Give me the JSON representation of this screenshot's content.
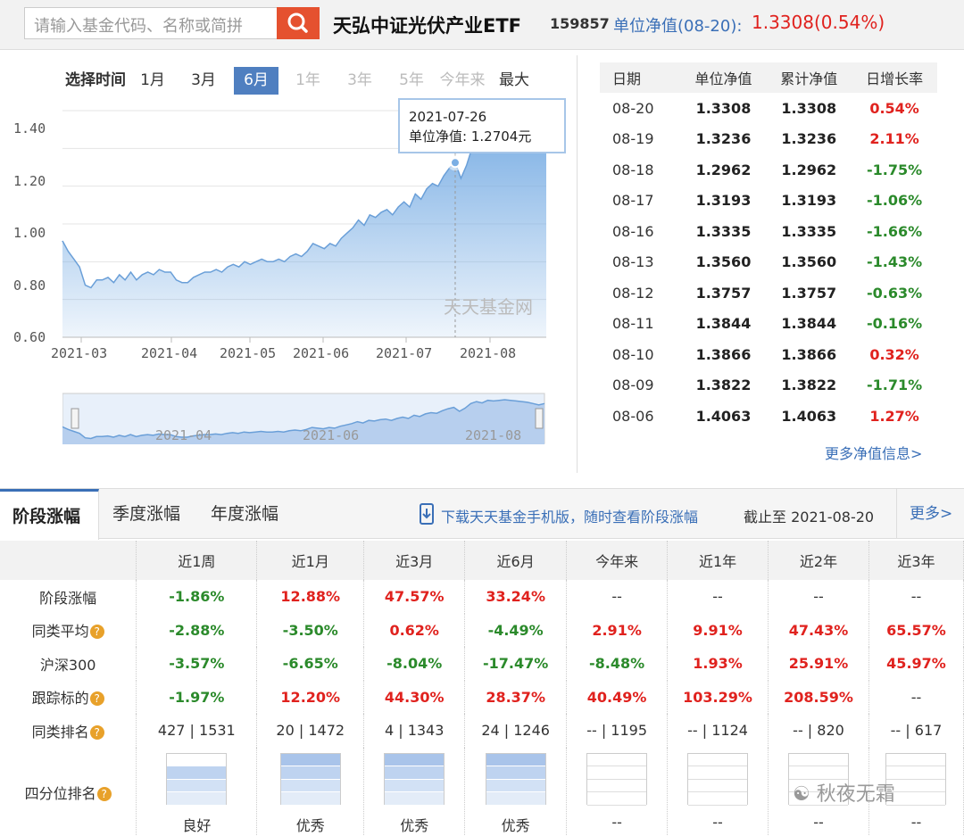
{
  "search": {
    "placeholder": "请输入基金代码、名称或简拼"
  },
  "fund": {
    "name": "天弘中证光伏产业ETF",
    "code": "159857",
    "nav_label": "单位净值(08-20):",
    "nav_value": "1.3308(0.54%)"
  },
  "chart_controls": {
    "label": "选择时间",
    "tabs": [
      "1月",
      "3月",
      "6月",
      "1年",
      "3年",
      "5年",
      "今年来",
      "最大"
    ],
    "active": "6月",
    "disabled": [
      "1年",
      "3年",
      "5年",
      "今年来"
    ]
  },
  "chart_data": {
    "type": "area",
    "x_ticks": [
      "2021-03",
      "2021-04",
      "2021-05",
      "2021-06",
      "2021-07",
      "2021-08"
    ],
    "y_ticks": [
      "0.60",
      "0.80",
      "1.00",
      "1.20",
      "1.40"
    ],
    "ylim": [
      0.6,
      1.47
    ],
    "values": [
      0.97,
      0.93,
      0.9,
      0.87,
      0.8,
      0.79,
      0.82,
      0.82,
      0.83,
      0.81,
      0.84,
      0.82,
      0.85,
      0.82,
      0.84,
      0.85,
      0.84,
      0.86,
      0.85,
      0.85,
      0.82,
      0.81,
      0.81,
      0.83,
      0.84,
      0.85,
      0.85,
      0.86,
      0.85,
      0.87,
      0.88,
      0.87,
      0.89,
      0.88,
      0.89,
      0.9,
      0.89,
      0.89,
      0.9,
      0.89,
      0.91,
      0.92,
      0.91,
      0.93,
      0.96,
      0.95,
      0.94,
      0.96,
      0.95,
      0.98,
      1.0,
      1.02,
      1.05,
      1.03,
      1.07,
      1.06,
      1.08,
      1.09,
      1.07,
      1.1,
      1.12,
      1.1,
      1.15,
      1.13,
      1.17,
      1.19,
      1.18,
      1.22,
      1.25,
      1.2704,
      1.21,
      1.26,
      1.33,
      1.36,
      1.34,
      1.38,
      1.37,
      1.38,
      1.39,
      1.38,
      1.37,
      1.36,
      1.35,
      1.33,
      1.31,
      1.3308
    ],
    "tooltip": {
      "date": "2021-07-26",
      "label": "单位净值:",
      "value": "1.2704元"
    },
    "navigator_ticks": [
      "2021-04",
      "2021-06",
      "2021-08"
    ],
    "watermark": "天天基金网",
    "color": "#7aaee4"
  },
  "nav_table": {
    "headers": [
      "日期",
      "单位净值",
      "累计净值",
      "日增长率"
    ],
    "rows": [
      [
        "08-20",
        "1.3308",
        "1.3308",
        "0.54%"
      ],
      [
        "08-19",
        "1.3236",
        "1.3236",
        "2.11%"
      ],
      [
        "08-18",
        "1.2962",
        "1.2962",
        "-1.75%"
      ],
      [
        "08-17",
        "1.3193",
        "1.3193",
        "-1.06%"
      ],
      [
        "08-16",
        "1.3335",
        "1.3335",
        "-1.66%"
      ],
      [
        "08-13",
        "1.3560",
        "1.3560",
        "-1.43%"
      ],
      [
        "08-12",
        "1.3757",
        "1.3757",
        "-0.63%"
      ],
      [
        "08-11",
        "1.3844",
        "1.3844",
        "-0.16%"
      ],
      [
        "08-10",
        "1.3866",
        "1.3866",
        "0.32%"
      ],
      [
        "08-09",
        "1.3822",
        "1.3822",
        "-1.71%"
      ],
      [
        "08-06",
        "1.4063",
        "1.4063",
        "1.27%"
      ]
    ],
    "more": "更多净值信息>"
  },
  "bottom": {
    "tabs": [
      "阶段涨幅",
      "季度涨幅",
      "年度涨幅"
    ],
    "download": "下载天天基金手机版，随时查看阶段涨幅",
    "asof": "截止至  2021-08-20",
    "more": "更多>",
    "headers": [
      "",
      "近1周",
      "近1月",
      "近3月",
      "近6月",
      "今年来",
      "近1年",
      "近2年",
      "近3年"
    ],
    "rows": [
      {
        "label": "阶段涨幅",
        "help": false,
        "cells": [
          "-1.86%",
          "12.88%",
          "47.57%",
          "33.24%",
          "--",
          "--",
          "--",
          "--"
        ]
      },
      {
        "label": "同类平均",
        "help": true,
        "cells": [
          "-2.88%",
          "-3.50%",
          "0.62%",
          "-4.49%",
          "2.91%",
          "9.91%",
          "47.43%",
          "65.57%"
        ]
      },
      {
        "label": "沪深300",
        "help": false,
        "cells": [
          "-3.57%",
          "-6.65%",
          "-8.04%",
          "-17.47%",
          "-8.48%",
          "1.93%",
          "25.91%",
          "45.97%"
        ]
      },
      {
        "label": "跟踪标的",
        "help": true,
        "cells": [
          "-1.97%",
          "12.20%",
          "44.30%",
          "28.37%",
          "40.49%",
          "103.29%",
          "208.59%",
          "--"
        ]
      },
      {
        "label": "同类排名",
        "help": true,
        "cells": [
          "427 | 1531",
          "20 | 1472",
          "4 | 1343",
          "24 | 1246",
          "-- | 1195",
          "-- | 1124",
          "-- | 820",
          "-- | 617"
        ]
      }
    ],
    "quartile_label": "四分位排名",
    "quartile": [
      {
        "level": 3,
        "text": "良好"
      },
      {
        "level": 4,
        "text": "优秀"
      },
      {
        "level": 4,
        "text": "优秀"
      },
      {
        "level": 4,
        "text": "优秀"
      },
      {
        "level": 0,
        "text": "--"
      },
      {
        "level": 0,
        "text": "--"
      },
      {
        "level": 0,
        "text": "--"
      },
      {
        "level": 0,
        "text": "--"
      }
    ],
    "footer_mark": "秋夜无霜"
  }
}
